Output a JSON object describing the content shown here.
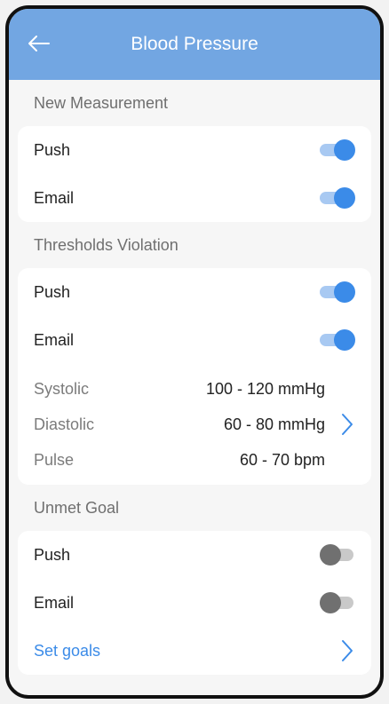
{
  "header": {
    "title": "Blood Pressure",
    "back_icon": "arrow-left-icon"
  },
  "sections": {
    "new_measurement": {
      "title": "New Measurement",
      "push_label": "Push",
      "push_on": true,
      "email_label": "Email",
      "email_on": true
    },
    "thresholds_violation": {
      "title": "Thresholds Violation",
      "push_label": "Push",
      "push_on": true,
      "email_label": "Email",
      "email_on": true,
      "rows": [
        {
          "label": "Systolic",
          "value": "100 - 120 mmHg"
        },
        {
          "label": "Diastolic",
          "value": "60 - 80 mmHg"
        },
        {
          "label": "Pulse",
          "value": "60 - 70 bpm"
        }
      ]
    },
    "unmet_goal": {
      "title": "Unmet Goal",
      "push_label": "Push",
      "push_on": false,
      "email_label": "Email",
      "email_on": false,
      "set_goals_label": "Set goals"
    }
  },
  "colors": {
    "header": "#72a6e2",
    "accent": "#3b8be8"
  }
}
